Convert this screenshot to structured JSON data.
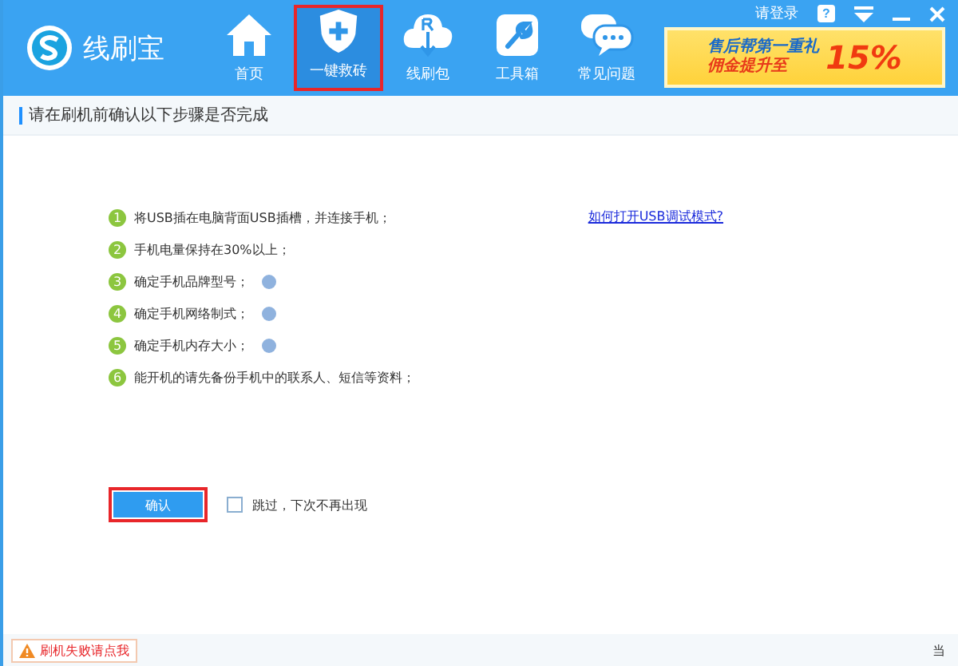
{
  "app": {
    "name": "线刷宝"
  },
  "nav": [
    {
      "label": "首页",
      "selected": false,
      "highlighted": false
    },
    {
      "label": "一键救砖",
      "selected": true,
      "highlighted": true
    },
    {
      "label": "线刷包",
      "selected": false,
      "highlighted": false
    },
    {
      "label": "工具箱",
      "selected": false,
      "highlighted": false
    },
    {
      "label": "常见问题",
      "selected": false,
      "highlighted": false
    }
  ],
  "top_bar": {
    "login": "请登录",
    "help_badge": "?"
  },
  "banner": {
    "line_1": "售后帮第一重礼",
    "line_2": "佣金提升至",
    "percent": "15%"
  },
  "section_title": "请在刷机前确认以下步骤是否完成",
  "steps": [
    {
      "number": "1",
      "text": "将USB插在电脑背面USB插槽，并连接手机；",
      "help": false
    },
    {
      "number": "2",
      "text": "手机电量保持在30%以上；",
      "help": false
    },
    {
      "number": "3",
      "text": "确定手机品牌型号；",
      "help": true
    },
    {
      "number": "4",
      "text": "确定手机网络制式；",
      "help": true
    },
    {
      "number": "5",
      "text": "确定手机内存大小；",
      "help": true
    },
    {
      "number": "6",
      "text": "能开机的请先备份手机中的联系人、短信等资料；",
      "help": false
    }
  ],
  "usb_link": "如何打开USB调试模式?",
  "confirm_button": {
    "label": "确认",
    "highlighted": true
  },
  "skip_checkbox": {
    "label": "跳过，下次不再出现",
    "checked": false
  },
  "footer": {
    "fail_button": "刷机失败请点我",
    "status": "当"
  }
}
